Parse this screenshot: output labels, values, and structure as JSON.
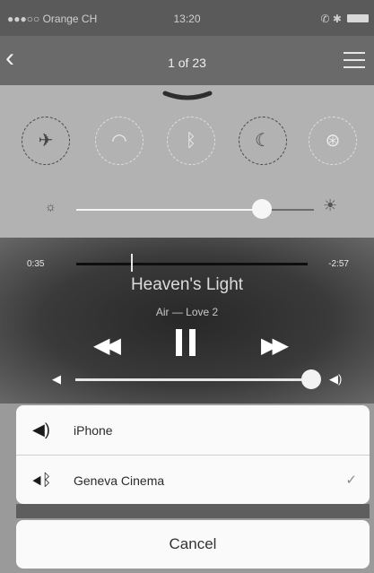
{
  "status_bar": {
    "carrier": "●●●○○ Orange CH",
    "time": "13:20",
    "right": "✆ ✱"
  },
  "nav": {
    "back_icon": "chevron-left-icon",
    "title": "1 of 23",
    "menu_icon": "list-icon"
  },
  "control_center": {
    "toggles": [
      "airplane-icon",
      "wifi-icon",
      "bluetooth-icon",
      "do-not-disturb-icon",
      "rotation-lock-icon"
    ],
    "brightness": 0.78
  },
  "player": {
    "elapsed": "0:35",
    "remaining": "-2:57",
    "song": "Heaven's Light",
    "artist": "Air — Love 2",
    "volume": 0.95
  },
  "audio_route_sheet": {
    "options": [
      {
        "label": "iPhone",
        "icon": "speaker-icon",
        "selected": false
      },
      {
        "label": "Geneva Cinema",
        "icon": "bluetooth-speaker-icon",
        "selected": true
      }
    ],
    "cancel_label": "Cancel"
  }
}
